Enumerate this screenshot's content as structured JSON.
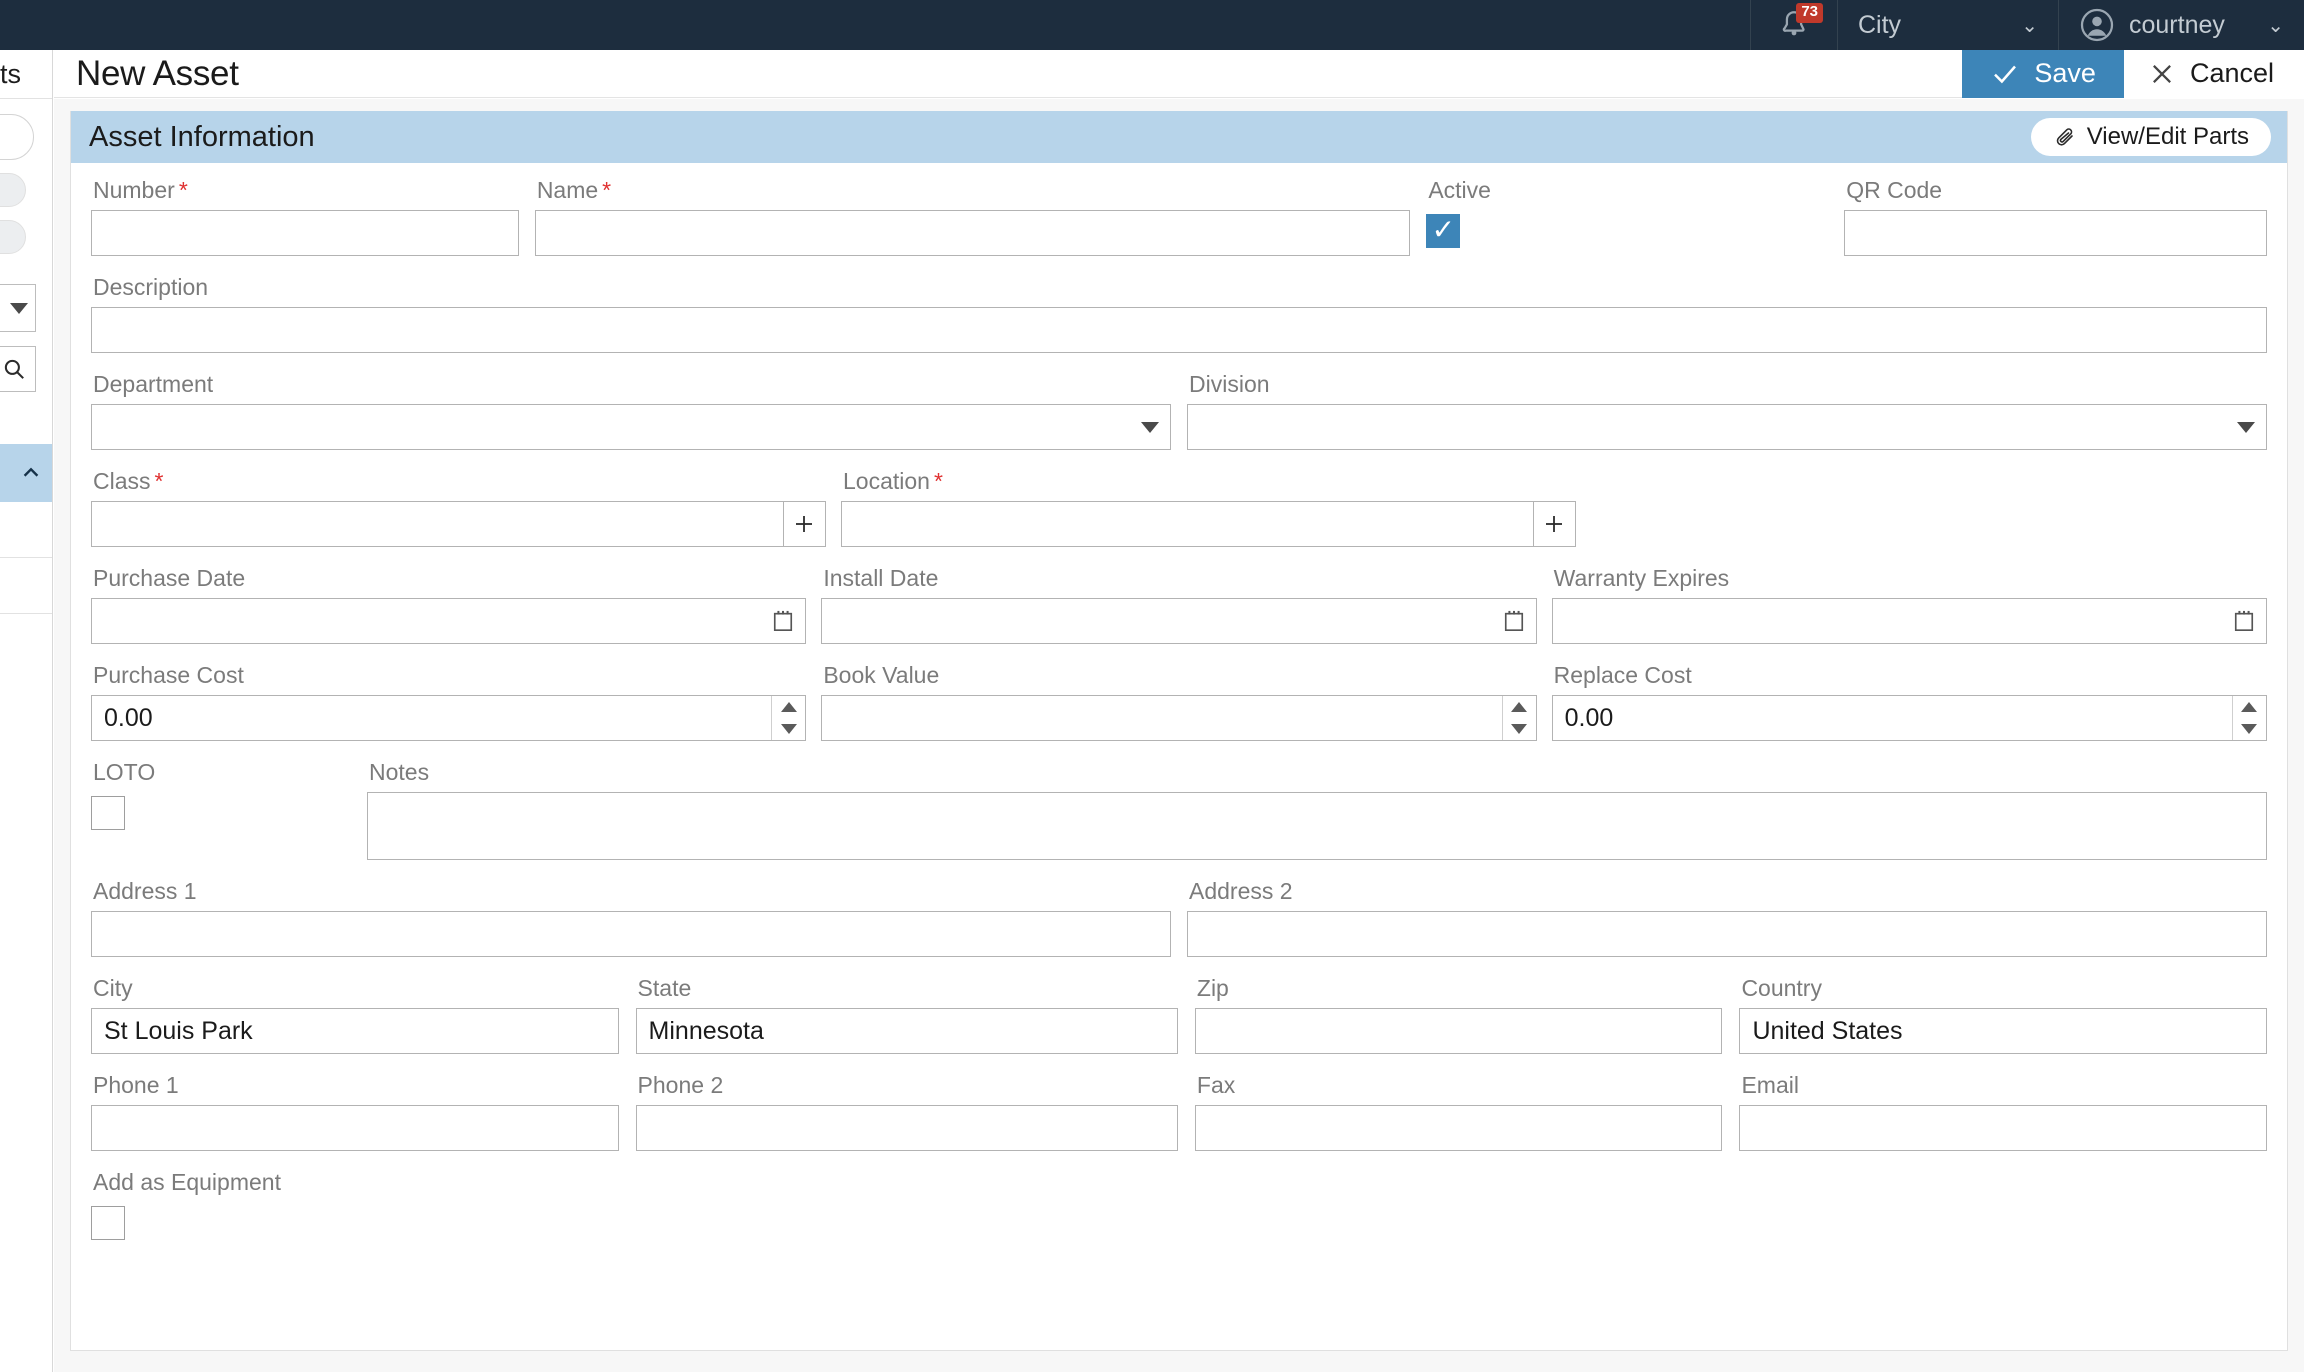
{
  "topbar": {
    "notification_icon": "bell-icon",
    "notification_count": "73",
    "site_selector": "City",
    "site_chevron": "chevron-down-icon",
    "user_icon": "user-avatar-icon",
    "username": "courtney",
    "user_chevron": "chevron-down-icon"
  },
  "sidebar": {
    "heading_clipped": "ts",
    "dropdown_icon": "chevron-down-icon",
    "search_icon": "search-icon",
    "collapse_icon": "chevron-up-icon"
  },
  "header": {
    "title": "New Asset",
    "save_label": "Save",
    "save_icon": "check-icon",
    "cancel_label": "Cancel",
    "cancel_icon": "close-icon"
  },
  "panel": {
    "title": "Asset Information",
    "parts_button_label": "View/Edit Parts",
    "parts_button_icon": "paperclip-icon"
  },
  "fields": {
    "number": {
      "label": "Number",
      "required": true,
      "value": ""
    },
    "name": {
      "label": "Name",
      "required": true,
      "value": ""
    },
    "active": {
      "label": "Active",
      "checked": true
    },
    "qr_code": {
      "label": "QR Code",
      "value": ""
    },
    "description": {
      "label": "Description",
      "value": ""
    },
    "department": {
      "label": "Department",
      "value": "",
      "icon": "chevron-down-icon"
    },
    "division": {
      "label": "Division",
      "value": "",
      "icon": "chevron-down-icon"
    },
    "class": {
      "label": "Class",
      "required": true,
      "value": "",
      "icon": "plus-icon"
    },
    "location": {
      "label": "Location",
      "required": true,
      "value": "",
      "icon": "plus-icon"
    },
    "purchase_date": {
      "label": "Purchase Date",
      "value": "",
      "icon": "calendar-icon"
    },
    "install_date": {
      "label": "Install Date",
      "value": "",
      "icon": "calendar-icon"
    },
    "warranty_expires": {
      "label": "Warranty Expires",
      "value": "",
      "icon": "calendar-icon"
    },
    "purchase_cost": {
      "label": "Purchase Cost",
      "value": "0.00",
      "icon": "spinner-icon"
    },
    "book_value": {
      "label": "Book Value",
      "value": "",
      "icon": "spinner-icon"
    },
    "replace_cost": {
      "label": "Replace Cost",
      "value": "0.00",
      "icon": "spinner-icon"
    },
    "loto": {
      "label": "LOTO",
      "checked": false
    },
    "notes": {
      "label": "Notes",
      "value": ""
    },
    "address1": {
      "label": "Address 1",
      "value": ""
    },
    "address2": {
      "label": "Address 2",
      "value": ""
    },
    "city": {
      "label": "City",
      "value": "St Louis Park"
    },
    "state": {
      "label": "State",
      "value": "Minnesota"
    },
    "zip": {
      "label": "Zip",
      "value": ""
    },
    "country": {
      "label": "Country",
      "value": "United States"
    },
    "phone1": {
      "label": "Phone 1",
      "value": ""
    },
    "phone2": {
      "label": "Phone 2",
      "value": ""
    },
    "fax": {
      "label": "Fax",
      "value": ""
    },
    "email": {
      "label": "Email",
      "value": ""
    },
    "add_as_equipment": {
      "label": "Add as Equipment",
      "checked": false
    }
  },
  "colors": {
    "topbar_bg": "#1d2d3e",
    "accent_blue": "#3d85b8",
    "panel_header_bg": "#b7d4ea",
    "required_red": "#e03131",
    "badge_red": "#c0392b"
  }
}
